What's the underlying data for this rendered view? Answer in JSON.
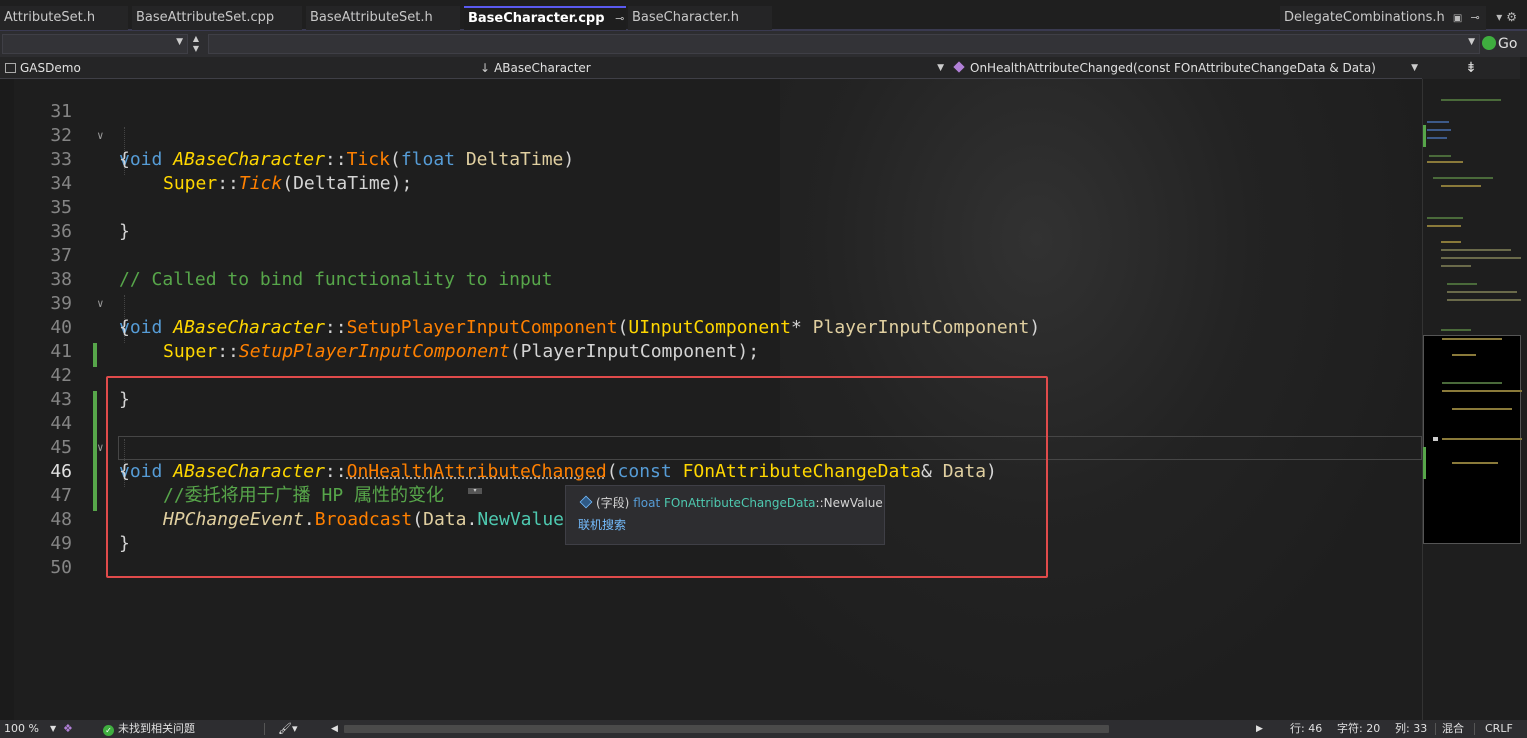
{
  "tabs": [
    {
      "label": "AttributeSet.h",
      "active": false
    },
    {
      "label": "BaseAttributeSet.cpp",
      "active": false
    },
    {
      "label": "BaseAttributeSet.h",
      "active": false
    },
    {
      "label": "BaseCharacter.cpp",
      "active": true
    },
    {
      "label": "BaseCharacter.h",
      "active": false
    }
  ],
  "pinned_tab": {
    "label": "DelegateCombinations.h"
  },
  "tab_icons": {
    "pin": "⊸",
    "close": "✕",
    "lock": "🔒"
  },
  "toolbar": {
    "go_label": "Go"
  },
  "navbar": {
    "project": "GASDemo",
    "class_scope": "ABaseCharacter",
    "member": "OnHealthAttributeChanged(const FOnAttributeChangeData & Data)"
  },
  "code": {
    "line_numbers": [
      "31",
      "32",
      "33",
      "34",
      "35",
      "36",
      "37",
      "38",
      "39",
      "40",
      "41",
      "42",
      "43",
      "44",
      "45",
      "46",
      "47",
      "48",
      "49",
      "50"
    ],
    "current_line": "46",
    "l31": {
      "kw": "void",
      "cls": "ABaseCharacter",
      "sep": "::",
      "fn": "Tick",
      "open": "(",
      "ptype": "float",
      "pname": "DeltaTime",
      "close": ")"
    },
    "l32": "{",
    "l33": {
      "sup": "Super",
      "sep": "::",
      "fn": "Tick",
      "args": "(DeltaTime);"
    },
    "l35": "}",
    "l37": "// Called to bind functionality to input",
    "l38": {
      "kw": "void",
      "cls": "ABaseCharacter",
      "sep": "::",
      "fn": "SetupPlayerInputComponent",
      "open": "(",
      "ptype": "UInputComponent",
      "star": "* ",
      "pname": "PlayerInputComponent",
      "close": ")"
    },
    "l39": "{",
    "l40": {
      "sup": "Super",
      "sep": "::",
      "fn": "SetupPlayerInputComponent",
      "args": "(PlayerInputComponent);"
    },
    "l42": "}",
    "l44": {
      "kw": "void",
      "cls": "ABaseCharacter",
      "sep": "::",
      "fn": "OnHealthAttributeChanged",
      "open": "(",
      "kw2": "const",
      "ptype": "FOnAttributeChangeData",
      "amp": "& ",
      "pname": "Data",
      "close": ")"
    },
    "l45": "{",
    "l46": "//委托将用于广播 HP 属性的变化",
    "l47": {
      "var": "HPChangeEvent",
      "dot": ".",
      "fn": "Broadcast",
      "open": "(",
      "obj": "Data",
      "dot2": ".",
      "mem": "NewValue",
      "close": ");"
    },
    "l48": "}"
  },
  "tooltip": {
    "kind": "(字段)",
    "type_kw": "float",
    "owner": "FOnAttributeChangeData",
    "sep": "::",
    "member": "NewValue",
    "link": "联机搜索"
  },
  "statusbar": {
    "zoom": "100 %",
    "issues": "未找到相关问题",
    "line": "行: 46",
    "char": "字符: 20",
    "col": "列: 33",
    "mixed": "混合",
    "eol": "CRLF"
  },
  "colors": {
    "accent_tab": "#5a5af0",
    "highlight_box": "#e04b4b",
    "change_bar": "#57a64a"
  }
}
